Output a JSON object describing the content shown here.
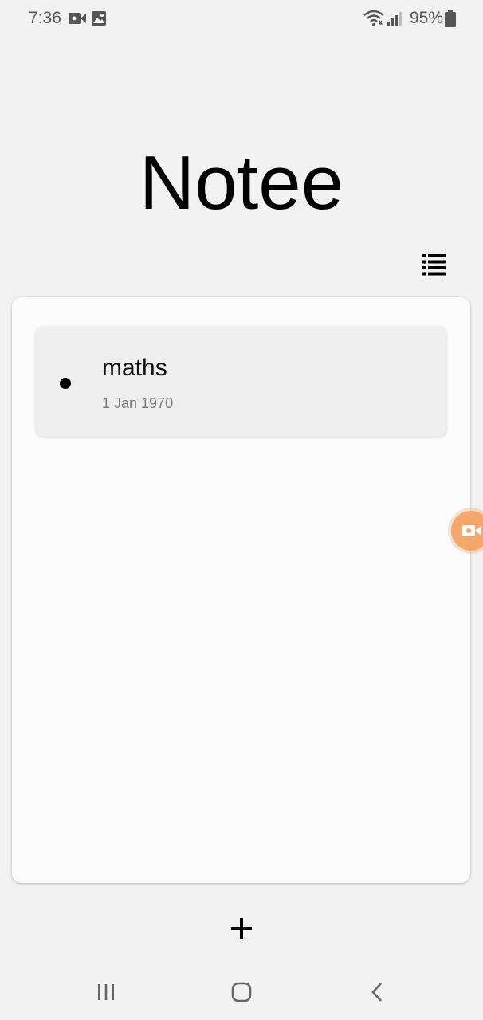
{
  "status_bar": {
    "time": "7:36",
    "battery_percent": "95%",
    "left_icons": [
      "video-camera-icon",
      "image-icon"
    ],
    "right_icons": [
      "wifi-icon",
      "signal-icon",
      "battery-icon"
    ]
  },
  "header": {
    "title": "Notee",
    "view_toggle_icon": "list-view-icon"
  },
  "notes": [
    {
      "title": "maths",
      "date": "1 Jan 1970",
      "bullet_color": "#000000"
    }
  ],
  "floating": {
    "recorder_icon": "video-camera-icon",
    "recorder_color": "#f6a86c"
  },
  "actions": {
    "add_icon": "plus-icon"
  },
  "nav": {
    "items": [
      "recent-apps-icon",
      "home-icon",
      "back-icon"
    ]
  },
  "colors": {
    "background": "#f2f2f2",
    "panel": "#fcfcfc",
    "note_item": "#efefef",
    "text_secondary": "#7a7a7a"
  }
}
